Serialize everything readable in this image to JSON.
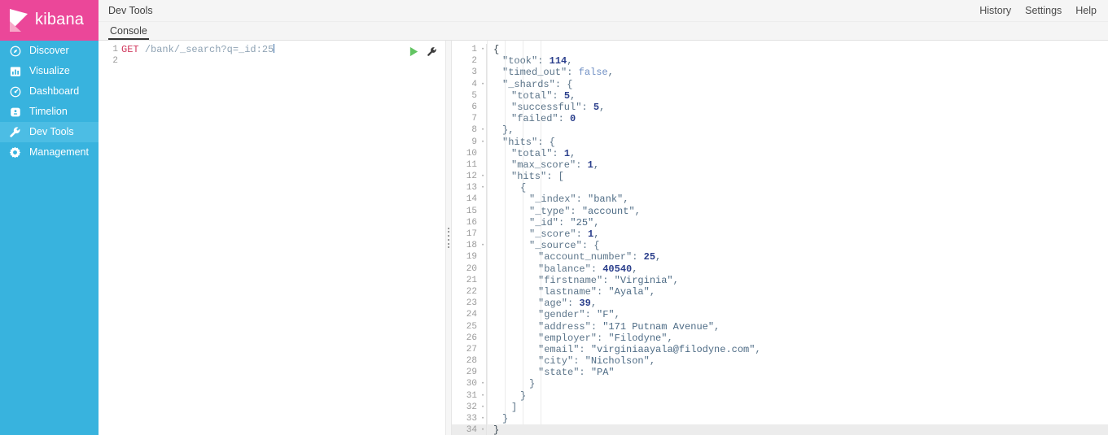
{
  "brand": {
    "name": "kibana",
    "logo_icon": "kibana-logo-icon",
    "bg_color": "#eb4799"
  },
  "sidebar": {
    "bg_color": "#38b3de",
    "active_bg_color": "#4cbde4",
    "items": [
      {
        "label": "Discover",
        "icon": "compass-icon",
        "active": false
      },
      {
        "label": "Visualize",
        "icon": "bar-chart-icon",
        "active": false
      },
      {
        "label": "Dashboard",
        "icon": "gauge-icon",
        "active": false
      },
      {
        "label": "Timelion",
        "icon": "clock-icon",
        "active": false
      },
      {
        "label": "Dev Tools",
        "icon": "wrench-icon",
        "active": true
      },
      {
        "label": "Management",
        "icon": "gear-icon",
        "active": false
      }
    ]
  },
  "header": {
    "app_title": "Dev Tools",
    "nav": [
      {
        "label": "History"
      },
      {
        "label": "Settings"
      },
      {
        "label": "Help"
      }
    ]
  },
  "tabs": [
    {
      "label": "Console",
      "active": true
    }
  ],
  "request_editor": {
    "play_icon": "play-icon",
    "wrench_icon": "wrench-icon",
    "lines": [
      {
        "number": "1",
        "fold": "",
        "tokens": [
          {
            "text": "GET ",
            "cls": "t-method"
          },
          {
            "text": "/bank/_search?q=_id:25",
            "cls": "t-url"
          }
        ],
        "caret": true,
        "highlight": false
      },
      {
        "number": "2",
        "fold": "",
        "tokens": [],
        "caret": false,
        "highlight": false
      }
    ]
  },
  "response_editor": {
    "lines": [
      {
        "number": "1",
        "fold": "·",
        "indent": 0,
        "tokens": [
          {
            "text": "{",
            "cls": "t-brace"
          }
        ],
        "highlight": false
      },
      {
        "number": "2",
        "fold": "",
        "indent": 1,
        "tokens": [
          {
            "text": "\"took\"",
            "cls": "t-key"
          },
          {
            "text": ": ",
            "cls": "t-punc"
          },
          {
            "text": "114",
            "cls": "t-num"
          },
          {
            "text": ",",
            "cls": "t-punc"
          }
        ],
        "highlight": false
      },
      {
        "number": "3",
        "fold": "",
        "indent": 1,
        "tokens": [
          {
            "text": "\"timed_out\"",
            "cls": "t-key"
          },
          {
            "text": ": ",
            "cls": "t-punc"
          },
          {
            "text": "false",
            "cls": "t-bool"
          },
          {
            "text": ",",
            "cls": "t-punc"
          }
        ],
        "highlight": false
      },
      {
        "number": "4",
        "fold": "·",
        "indent": 1,
        "tokens": [
          {
            "text": "\"_shards\"",
            "cls": "t-key"
          },
          {
            "text": ": {",
            "cls": "t-punc"
          }
        ],
        "highlight": false
      },
      {
        "number": "5",
        "fold": "",
        "indent": 2,
        "tokens": [
          {
            "text": "\"total\"",
            "cls": "t-key"
          },
          {
            "text": ": ",
            "cls": "t-punc"
          },
          {
            "text": "5",
            "cls": "t-num"
          },
          {
            "text": ",",
            "cls": "t-punc"
          }
        ],
        "highlight": false
      },
      {
        "number": "6",
        "fold": "",
        "indent": 2,
        "tokens": [
          {
            "text": "\"successful\"",
            "cls": "t-key"
          },
          {
            "text": ": ",
            "cls": "t-punc"
          },
          {
            "text": "5",
            "cls": "t-num"
          },
          {
            "text": ",",
            "cls": "t-punc"
          }
        ],
        "highlight": false
      },
      {
        "number": "7",
        "fold": "",
        "indent": 2,
        "tokens": [
          {
            "text": "\"failed\"",
            "cls": "t-key"
          },
          {
            "text": ": ",
            "cls": "t-punc"
          },
          {
            "text": "0",
            "cls": "t-num"
          }
        ],
        "highlight": false
      },
      {
        "number": "8",
        "fold": "·",
        "indent": 1,
        "tokens": [
          {
            "text": "},",
            "cls": "t-punc"
          }
        ],
        "highlight": false
      },
      {
        "number": "9",
        "fold": "·",
        "indent": 1,
        "tokens": [
          {
            "text": "\"hits\"",
            "cls": "t-key"
          },
          {
            "text": ": {",
            "cls": "t-punc"
          }
        ],
        "highlight": false
      },
      {
        "number": "10",
        "fold": "",
        "indent": 2,
        "tokens": [
          {
            "text": "\"total\"",
            "cls": "t-key"
          },
          {
            "text": ": ",
            "cls": "t-punc"
          },
          {
            "text": "1",
            "cls": "t-num"
          },
          {
            "text": ",",
            "cls": "t-punc"
          }
        ],
        "highlight": false
      },
      {
        "number": "11",
        "fold": "",
        "indent": 2,
        "tokens": [
          {
            "text": "\"max_score\"",
            "cls": "t-key"
          },
          {
            "text": ": ",
            "cls": "t-punc"
          },
          {
            "text": "1",
            "cls": "t-num"
          },
          {
            "text": ",",
            "cls": "t-punc"
          }
        ],
        "highlight": false
      },
      {
        "number": "12",
        "fold": "·",
        "indent": 2,
        "tokens": [
          {
            "text": "\"hits\"",
            "cls": "t-key"
          },
          {
            "text": ": [",
            "cls": "t-punc"
          }
        ],
        "highlight": false
      },
      {
        "number": "13",
        "fold": "·",
        "indent": 3,
        "tokens": [
          {
            "text": "{",
            "cls": "t-punc"
          }
        ],
        "highlight": false
      },
      {
        "number": "14",
        "fold": "",
        "indent": 4,
        "tokens": [
          {
            "text": "\"_index\"",
            "cls": "t-key"
          },
          {
            "text": ": ",
            "cls": "t-punc"
          },
          {
            "text": "\"bank\"",
            "cls": "t-str"
          },
          {
            "text": ",",
            "cls": "t-punc"
          }
        ],
        "highlight": false
      },
      {
        "number": "15",
        "fold": "",
        "indent": 4,
        "tokens": [
          {
            "text": "\"_type\"",
            "cls": "t-key"
          },
          {
            "text": ": ",
            "cls": "t-punc"
          },
          {
            "text": "\"account\"",
            "cls": "t-str"
          },
          {
            "text": ",",
            "cls": "t-punc"
          }
        ],
        "highlight": false
      },
      {
        "number": "16",
        "fold": "",
        "indent": 4,
        "tokens": [
          {
            "text": "\"_id\"",
            "cls": "t-key"
          },
          {
            "text": ": ",
            "cls": "t-punc"
          },
          {
            "text": "\"25\"",
            "cls": "t-str"
          },
          {
            "text": ",",
            "cls": "t-punc"
          }
        ],
        "highlight": false
      },
      {
        "number": "17",
        "fold": "",
        "indent": 4,
        "tokens": [
          {
            "text": "\"_score\"",
            "cls": "t-key"
          },
          {
            "text": ": ",
            "cls": "t-punc"
          },
          {
            "text": "1",
            "cls": "t-num"
          },
          {
            "text": ",",
            "cls": "t-punc"
          }
        ],
        "highlight": false
      },
      {
        "number": "18",
        "fold": "·",
        "indent": 4,
        "tokens": [
          {
            "text": "\"_source\"",
            "cls": "t-key"
          },
          {
            "text": ": {",
            "cls": "t-punc"
          }
        ],
        "highlight": false
      },
      {
        "number": "19",
        "fold": "",
        "indent": 5,
        "tokens": [
          {
            "text": "\"account_number\"",
            "cls": "t-key"
          },
          {
            "text": ": ",
            "cls": "t-punc"
          },
          {
            "text": "25",
            "cls": "t-num"
          },
          {
            "text": ",",
            "cls": "t-punc"
          }
        ],
        "highlight": false
      },
      {
        "number": "20",
        "fold": "",
        "indent": 5,
        "tokens": [
          {
            "text": "\"balance\"",
            "cls": "t-key"
          },
          {
            "text": ": ",
            "cls": "t-punc"
          },
          {
            "text": "40540",
            "cls": "t-num"
          },
          {
            "text": ",",
            "cls": "t-punc"
          }
        ],
        "highlight": false
      },
      {
        "number": "21",
        "fold": "",
        "indent": 5,
        "tokens": [
          {
            "text": "\"firstname\"",
            "cls": "t-key"
          },
          {
            "text": ": ",
            "cls": "t-punc"
          },
          {
            "text": "\"Virginia\"",
            "cls": "t-str"
          },
          {
            "text": ",",
            "cls": "t-punc"
          }
        ],
        "highlight": false
      },
      {
        "number": "22",
        "fold": "",
        "indent": 5,
        "tokens": [
          {
            "text": "\"lastname\"",
            "cls": "t-key"
          },
          {
            "text": ": ",
            "cls": "t-punc"
          },
          {
            "text": "\"Ayala\"",
            "cls": "t-str"
          },
          {
            "text": ",",
            "cls": "t-punc"
          }
        ],
        "highlight": false
      },
      {
        "number": "23",
        "fold": "",
        "indent": 5,
        "tokens": [
          {
            "text": "\"age\"",
            "cls": "t-key"
          },
          {
            "text": ": ",
            "cls": "t-punc"
          },
          {
            "text": "39",
            "cls": "t-num"
          },
          {
            "text": ",",
            "cls": "t-punc"
          }
        ],
        "highlight": false
      },
      {
        "number": "24",
        "fold": "",
        "indent": 5,
        "tokens": [
          {
            "text": "\"gender\"",
            "cls": "t-key"
          },
          {
            "text": ": ",
            "cls": "t-punc"
          },
          {
            "text": "\"F\"",
            "cls": "t-str"
          },
          {
            "text": ",",
            "cls": "t-punc"
          }
        ],
        "highlight": false
      },
      {
        "number": "25",
        "fold": "",
        "indent": 5,
        "tokens": [
          {
            "text": "\"address\"",
            "cls": "t-key"
          },
          {
            "text": ": ",
            "cls": "t-punc"
          },
          {
            "text": "\"171 Putnam Avenue\"",
            "cls": "t-str"
          },
          {
            "text": ",",
            "cls": "t-punc"
          }
        ],
        "highlight": false
      },
      {
        "number": "26",
        "fold": "",
        "indent": 5,
        "tokens": [
          {
            "text": "\"employer\"",
            "cls": "t-key"
          },
          {
            "text": ": ",
            "cls": "t-punc"
          },
          {
            "text": "\"Filodyne\"",
            "cls": "t-str"
          },
          {
            "text": ",",
            "cls": "t-punc"
          }
        ],
        "highlight": false
      },
      {
        "number": "27",
        "fold": "",
        "indent": 5,
        "tokens": [
          {
            "text": "\"email\"",
            "cls": "t-key"
          },
          {
            "text": ": ",
            "cls": "t-punc"
          },
          {
            "text": "\"virginiaayala@filodyne.com\"",
            "cls": "t-str"
          },
          {
            "text": ",",
            "cls": "t-punc"
          }
        ],
        "highlight": false
      },
      {
        "number": "28",
        "fold": "",
        "indent": 5,
        "tokens": [
          {
            "text": "\"city\"",
            "cls": "t-key"
          },
          {
            "text": ": ",
            "cls": "t-punc"
          },
          {
            "text": "\"Nicholson\"",
            "cls": "t-str"
          },
          {
            "text": ",",
            "cls": "t-punc"
          }
        ],
        "highlight": false
      },
      {
        "number": "29",
        "fold": "",
        "indent": 5,
        "tokens": [
          {
            "text": "\"state\"",
            "cls": "t-key"
          },
          {
            "text": ": ",
            "cls": "t-punc"
          },
          {
            "text": "\"PA\"",
            "cls": "t-str"
          }
        ],
        "highlight": false
      },
      {
        "number": "30",
        "fold": "·",
        "indent": 4,
        "tokens": [
          {
            "text": "}",
            "cls": "t-punc"
          }
        ],
        "highlight": false
      },
      {
        "number": "31",
        "fold": "·",
        "indent": 3,
        "tokens": [
          {
            "text": "}",
            "cls": "t-punc"
          }
        ],
        "highlight": false
      },
      {
        "number": "32",
        "fold": "·",
        "indent": 2,
        "tokens": [
          {
            "text": "]",
            "cls": "t-punc"
          }
        ],
        "highlight": false
      },
      {
        "number": "33",
        "fold": "·",
        "indent": 1,
        "tokens": [
          {
            "text": "}",
            "cls": "t-punc"
          }
        ],
        "highlight": false
      },
      {
        "number": "34",
        "fold": "·",
        "indent": 0,
        "tokens": [
          {
            "text": "}",
            "cls": "t-brace"
          }
        ],
        "highlight": true
      }
    ]
  }
}
